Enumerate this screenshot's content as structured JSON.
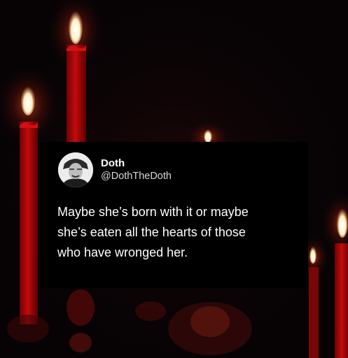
{
  "tweet": {
    "author_name": "Doth",
    "author_handle": "@DothTheDoth",
    "text_lines": [
      "Maybe she’s born with it or maybe",
      "she’s eaten all the hearts of those",
      "who have wronged her."
    ]
  },
  "background": {
    "description_icon": "red-candles",
    "colors": {
      "base": "#070305",
      "candle": "#b3070a",
      "flame": "#fff4d8",
      "glow": "#ff5a1e"
    }
  }
}
